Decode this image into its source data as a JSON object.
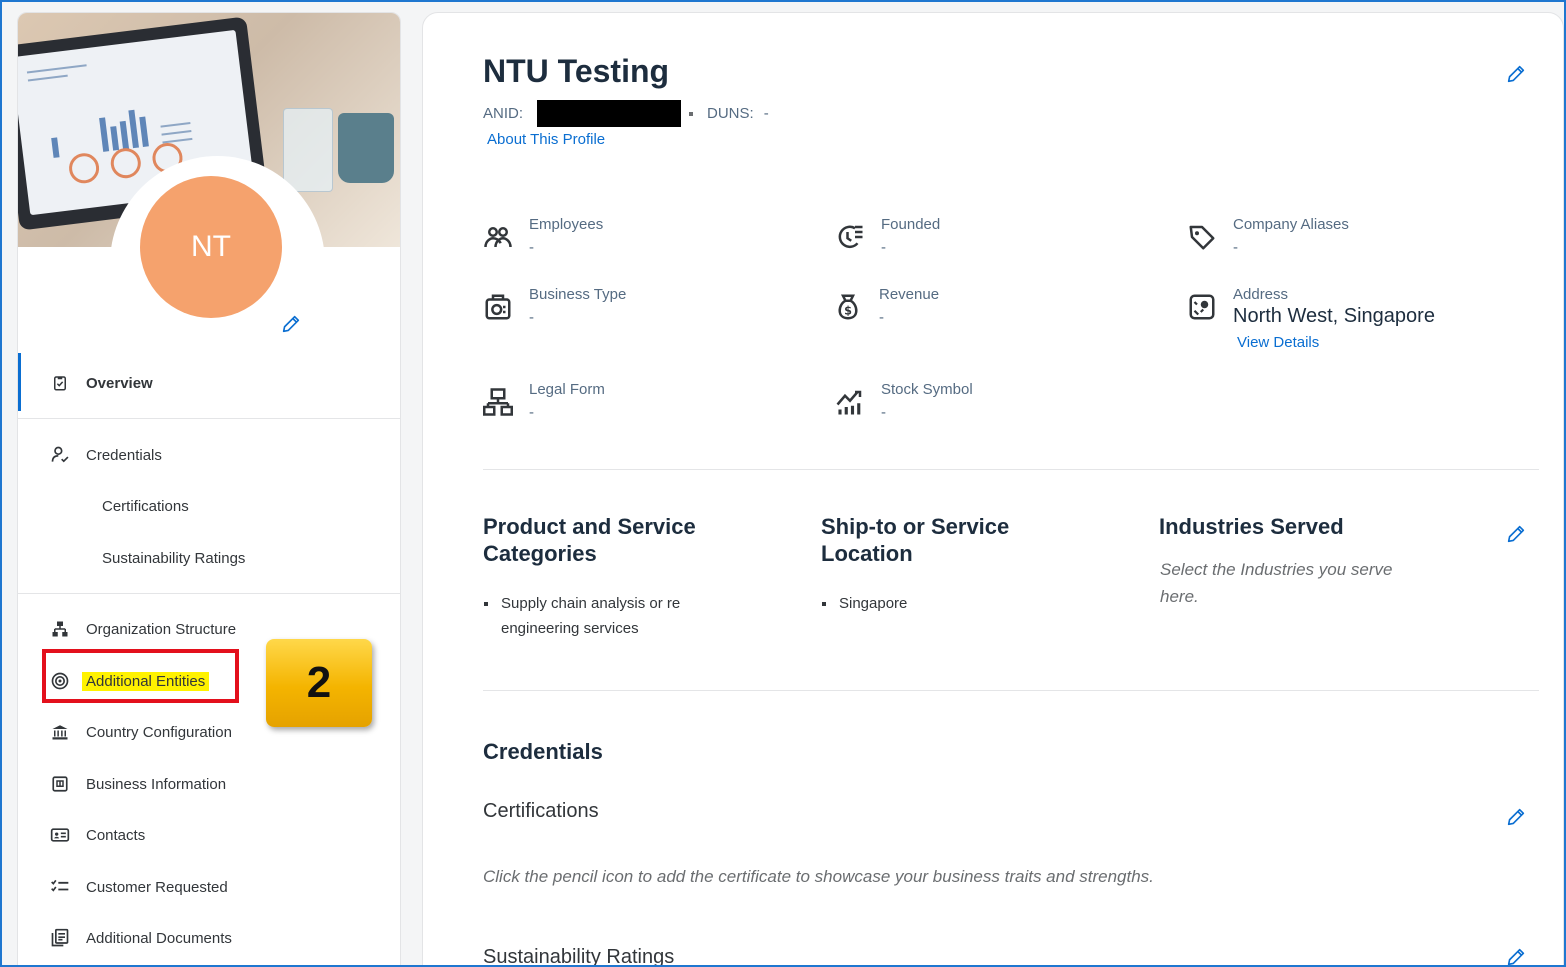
{
  "profile": {
    "initials": "NT",
    "company_name": "NTU Testing",
    "anid_label": "ANID:",
    "duns_label": "DUNS:",
    "duns_value": "-",
    "about_link": "About This Profile"
  },
  "sidebar": {
    "overview": "Overview",
    "credentials": "Credentials",
    "certifications": "Certifications",
    "sustainability_ratings": "Sustainability Ratings",
    "organization_structure": "Organization Structure",
    "additional_entities": "Additional Entities",
    "country_configuration": "Country Configuration",
    "business_information": "Business Information",
    "contacts": "Contacts",
    "customer_requested": "Customer Requested",
    "additional_documents": "Additional Documents"
  },
  "callout": {
    "step_number": "2",
    "highlight_color": "#fff200",
    "box_color": "#e3101c"
  },
  "overview_fields": {
    "employees": {
      "label": "Employees",
      "value": "-"
    },
    "founded": {
      "label": "Founded",
      "value": "-"
    },
    "company_aliases": {
      "label": "Company Aliases",
      "value": "-"
    },
    "business_type": {
      "label": "Business Type",
      "value": "-"
    },
    "revenue": {
      "label": "Revenue",
      "value": "-"
    },
    "address": {
      "label": "Address",
      "value": "North West, Singapore",
      "link": "View Details"
    },
    "legal_form": {
      "label": "Legal Form",
      "value": "-"
    },
    "stock_symbol": {
      "label": "Stock Symbol",
      "value": "-"
    }
  },
  "categories": {
    "product_heading_line1": "Product and Service",
    "product_heading_line2": "Categories",
    "product_item_line1": "Supply chain analysis or re",
    "product_item_line2": "engineering services",
    "ship_heading_line1": "Ship-to or Service",
    "ship_heading_line2": "Location",
    "ship_item": "Singapore",
    "industries_heading": "Industries Served",
    "industries_hint_line1": "Select the Industries you serve",
    "industries_hint_line2": "here."
  },
  "credentials_section": {
    "heading": "Credentials",
    "certifications_heading": "Certifications",
    "certifications_hint": "Click the pencil icon to add the certificate to showcase your business traits and strengths.",
    "sustainability_heading": "Sustainability Ratings"
  },
  "colors": {
    "accent": "#0a6ed1",
    "avatar": "#f5a26d",
    "frame": "#1f77d0"
  },
  "icons": [
    "pencil-icon",
    "employees-icon",
    "founded-icon",
    "tag-icon",
    "business-type-icon",
    "revenue-icon",
    "address-icon",
    "legal-form-icon",
    "stock-icon",
    "overview-icon",
    "credentials-icon",
    "org-structure-icon",
    "entities-icon",
    "bank-icon",
    "business-info-icon",
    "contacts-icon",
    "checklist-icon",
    "documents-icon"
  ]
}
